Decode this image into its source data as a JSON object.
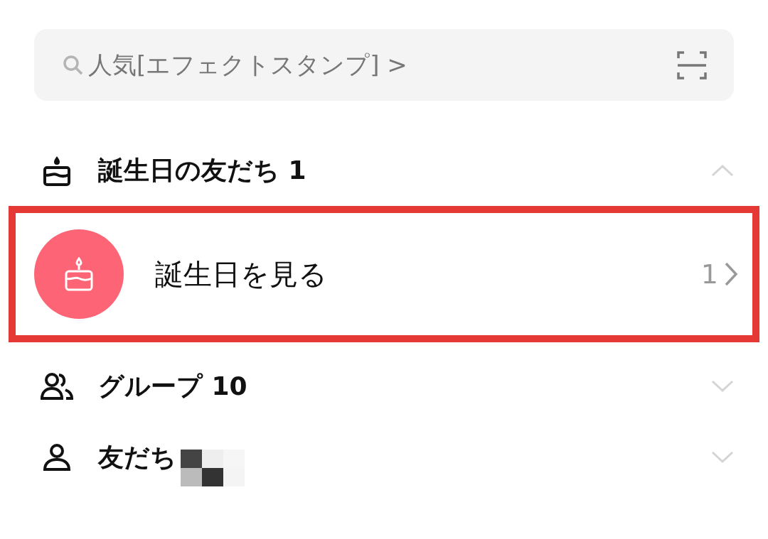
{
  "search": {
    "placeholder": "人気[エフェクトスタンプ] >"
  },
  "sections": [
    {
      "kind": "birthday",
      "title": "誕生日の友だち 1",
      "expanded": true,
      "rows": [
        {
          "label": "誕生日を見る",
          "count": "1",
          "highlighted": true
        }
      ]
    },
    {
      "kind": "group",
      "title": "グループ 10",
      "expanded": false
    },
    {
      "kind": "friend",
      "title": "友だち",
      "expanded": false,
      "redacted": true
    }
  ]
}
